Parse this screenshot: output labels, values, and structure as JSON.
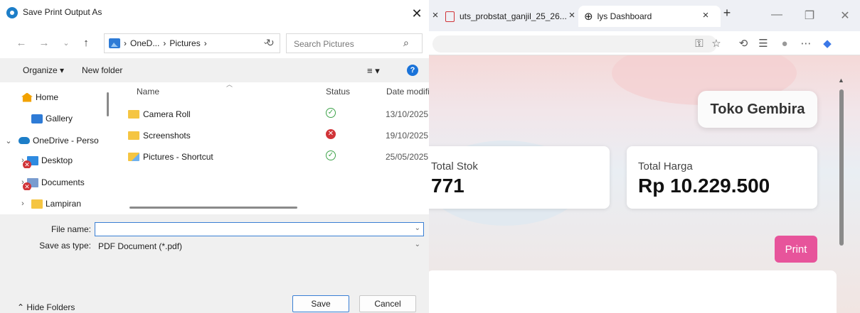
{
  "browser": {
    "tabs": [
      {
        "label": "uts_probstat_ganjil_25_26..."
      },
      {
        "label": "lys Dashboard"
      }
    ],
    "new_tab": "+",
    "window_controls": {
      "minimize": "—",
      "restore": "❐",
      "close": "✕"
    }
  },
  "page": {
    "brand": "Toko Gembira",
    "cards": [
      {
        "label": "Total Stok",
        "value": "771"
      },
      {
        "label": "Total Harga",
        "value": "Rp 10.229.500"
      }
    ],
    "print_label": "Print"
  },
  "dialog": {
    "title": "Save Print Output As",
    "breadcrumb": [
      "OneD...",
      "Pictures"
    ],
    "search_placeholder": "Search Pictures",
    "organize": "Organize ▾",
    "new_folder": "New folder",
    "nav_items": [
      {
        "label": "Home",
        "icon": "home-icon"
      },
      {
        "label": "Gallery",
        "icon": "gallery-icon"
      },
      {
        "label": "OneDrive - Perso",
        "icon": "onedrive-icon"
      },
      {
        "label": "Desktop",
        "icon": "desktop-icon"
      },
      {
        "label": "Documents",
        "icon": "documents-icon"
      },
      {
        "label": "Lampiran",
        "icon": "folder-icon"
      }
    ],
    "columns": {
      "name": "Name",
      "status": "Status",
      "date": "Date modifi"
    },
    "files": [
      {
        "name": "Camera Roll",
        "status": "synced",
        "date": "13/10/2025"
      },
      {
        "name": "Screenshots",
        "status": "error",
        "date": "19/10/2025"
      },
      {
        "name": "Pictures - Shortcut",
        "status": "synced",
        "date": "25/05/2025"
      }
    ],
    "file_name_label": "File name:",
    "file_name_value": "",
    "save_type_label": "Save as type:",
    "save_type_value": "PDF Document (*.pdf)",
    "hide_folders": "Hide Folders",
    "save_button": "Save",
    "cancel_button": "Cancel"
  },
  "colors": {
    "accent": "#e7549b",
    "dialog_focus": "#3a7fd4",
    "error": "#d13438",
    "ok": "#3ea34a"
  }
}
